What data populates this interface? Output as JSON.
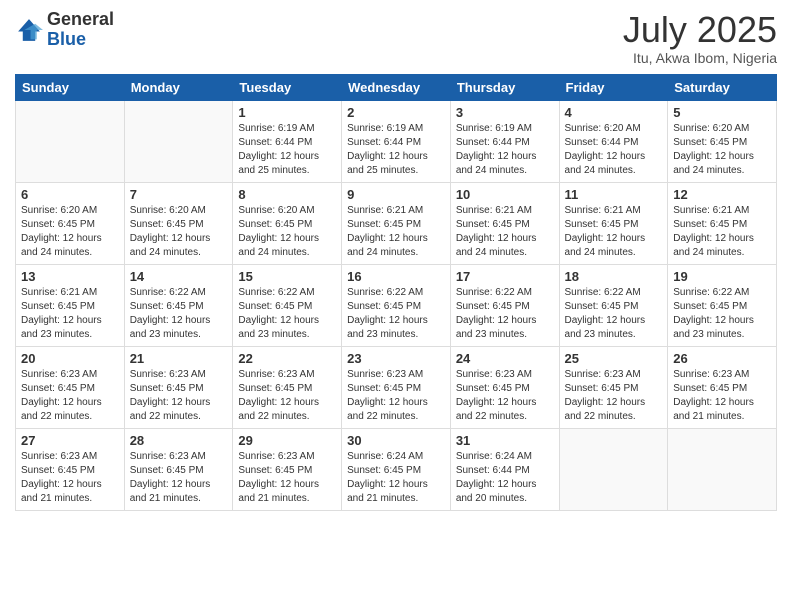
{
  "header": {
    "logo_general": "General",
    "logo_blue": "Blue",
    "month_title": "July 2025",
    "subtitle": "Itu, Akwa Ibom, Nigeria"
  },
  "weekdays": [
    "Sunday",
    "Monday",
    "Tuesday",
    "Wednesday",
    "Thursday",
    "Friday",
    "Saturday"
  ],
  "weeks": [
    [
      {
        "day": "",
        "info": ""
      },
      {
        "day": "",
        "info": ""
      },
      {
        "day": "1",
        "info": "Sunrise: 6:19 AM\nSunset: 6:44 PM\nDaylight: 12 hours and 25 minutes."
      },
      {
        "day": "2",
        "info": "Sunrise: 6:19 AM\nSunset: 6:44 PM\nDaylight: 12 hours and 25 minutes."
      },
      {
        "day": "3",
        "info": "Sunrise: 6:19 AM\nSunset: 6:44 PM\nDaylight: 12 hours and 24 minutes."
      },
      {
        "day": "4",
        "info": "Sunrise: 6:20 AM\nSunset: 6:44 PM\nDaylight: 12 hours and 24 minutes."
      },
      {
        "day": "5",
        "info": "Sunrise: 6:20 AM\nSunset: 6:45 PM\nDaylight: 12 hours and 24 minutes."
      }
    ],
    [
      {
        "day": "6",
        "info": "Sunrise: 6:20 AM\nSunset: 6:45 PM\nDaylight: 12 hours and 24 minutes."
      },
      {
        "day": "7",
        "info": "Sunrise: 6:20 AM\nSunset: 6:45 PM\nDaylight: 12 hours and 24 minutes."
      },
      {
        "day": "8",
        "info": "Sunrise: 6:20 AM\nSunset: 6:45 PM\nDaylight: 12 hours and 24 minutes."
      },
      {
        "day": "9",
        "info": "Sunrise: 6:21 AM\nSunset: 6:45 PM\nDaylight: 12 hours and 24 minutes."
      },
      {
        "day": "10",
        "info": "Sunrise: 6:21 AM\nSunset: 6:45 PM\nDaylight: 12 hours and 24 minutes."
      },
      {
        "day": "11",
        "info": "Sunrise: 6:21 AM\nSunset: 6:45 PM\nDaylight: 12 hours and 24 minutes."
      },
      {
        "day": "12",
        "info": "Sunrise: 6:21 AM\nSunset: 6:45 PM\nDaylight: 12 hours and 24 minutes."
      }
    ],
    [
      {
        "day": "13",
        "info": "Sunrise: 6:21 AM\nSunset: 6:45 PM\nDaylight: 12 hours and 23 minutes."
      },
      {
        "day": "14",
        "info": "Sunrise: 6:22 AM\nSunset: 6:45 PM\nDaylight: 12 hours and 23 minutes."
      },
      {
        "day": "15",
        "info": "Sunrise: 6:22 AM\nSunset: 6:45 PM\nDaylight: 12 hours and 23 minutes."
      },
      {
        "day": "16",
        "info": "Sunrise: 6:22 AM\nSunset: 6:45 PM\nDaylight: 12 hours and 23 minutes."
      },
      {
        "day": "17",
        "info": "Sunrise: 6:22 AM\nSunset: 6:45 PM\nDaylight: 12 hours and 23 minutes."
      },
      {
        "day": "18",
        "info": "Sunrise: 6:22 AM\nSunset: 6:45 PM\nDaylight: 12 hours and 23 minutes."
      },
      {
        "day": "19",
        "info": "Sunrise: 6:22 AM\nSunset: 6:45 PM\nDaylight: 12 hours and 23 minutes."
      }
    ],
    [
      {
        "day": "20",
        "info": "Sunrise: 6:23 AM\nSunset: 6:45 PM\nDaylight: 12 hours and 22 minutes."
      },
      {
        "day": "21",
        "info": "Sunrise: 6:23 AM\nSunset: 6:45 PM\nDaylight: 12 hours and 22 minutes."
      },
      {
        "day": "22",
        "info": "Sunrise: 6:23 AM\nSunset: 6:45 PM\nDaylight: 12 hours and 22 minutes."
      },
      {
        "day": "23",
        "info": "Sunrise: 6:23 AM\nSunset: 6:45 PM\nDaylight: 12 hours and 22 minutes."
      },
      {
        "day": "24",
        "info": "Sunrise: 6:23 AM\nSunset: 6:45 PM\nDaylight: 12 hours and 22 minutes."
      },
      {
        "day": "25",
        "info": "Sunrise: 6:23 AM\nSunset: 6:45 PM\nDaylight: 12 hours and 22 minutes."
      },
      {
        "day": "26",
        "info": "Sunrise: 6:23 AM\nSunset: 6:45 PM\nDaylight: 12 hours and 21 minutes."
      }
    ],
    [
      {
        "day": "27",
        "info": "Sunrise: 6:23 AM\nSunset: 6:45 PM\nDaylight: 12 hours and 21 minutes."
      },
      {
        "day": "28",
        "info": "Sunrise: 6:23 AM\nSunset: 6:45 PM\nDaylight: 12 hours and 21 minutes."
      },
      {
        "day": "29",
        "info": "Sunrise: 6:23 AM\nSunset: 6:45 PM\nDaylight: 12 hours and 21 minutes."
      },
      {
        "day": "30",
        "info": "Sunrise: 6:24 AM\nSunset: 6:45 PM\nDaylight: 12 hours and 21 minutes."
      },
      {
        "day": "31",
        "info": "Sunrise: 6:24 AM\nSunset: 6:44 PM\nDaylight: 12 hours and 20 minutes."
      },
      {
        "day": "",
        "info": ""
      },
      {
        "day": "",
        "info": ""
      }
    ]
  ]
}
